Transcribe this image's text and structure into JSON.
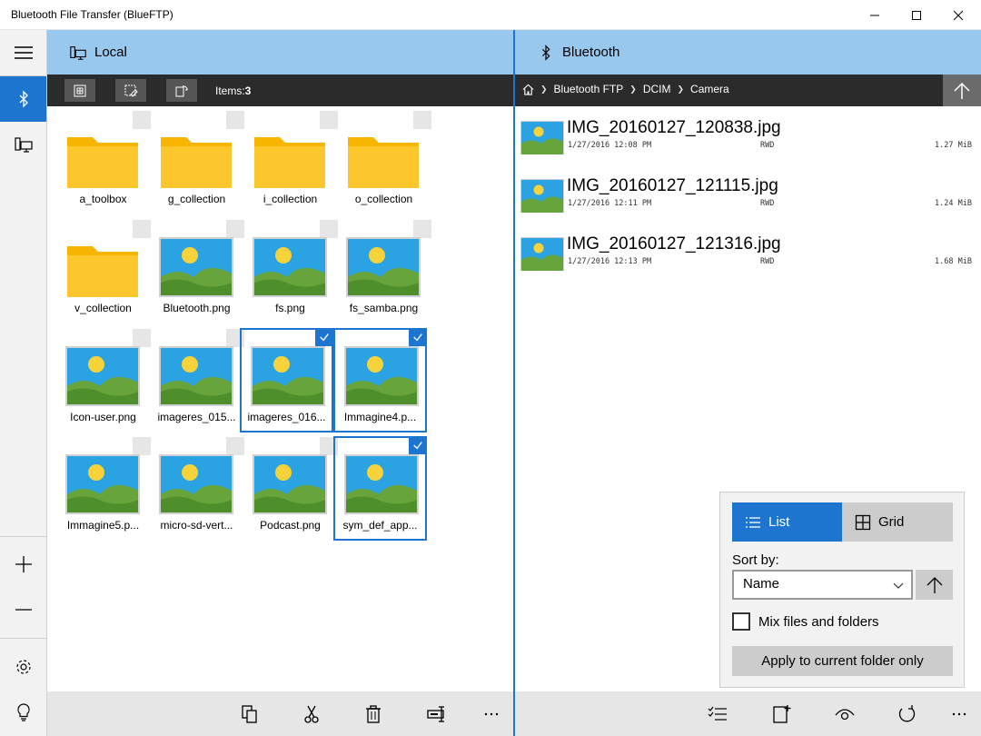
{
  "window": {
    "title": "Bluetooth File Transfer (BlueFTP)"
  },
  "left_pane": {
    "title": "Local",
    "items_label": "Items:",
    "items_count": "3",
    "tiles": [
      {
        "label": "a_toolbox",
        "kind": "folder",
        "selected": false
      },
      {
        "label": "g_collection",
        "kind": "folder",
        "selected": false
      },
      {
        "label": "i_collection",
        "kind": "folder",
        "selected": false
      },
      {
        "label": "o_collection",
        "kind": "folder",
        "selected": false
      },
      {
        "label": "v_collection",
        "kind": "folder",
        "selected": false
      },
      {
        "label": "Bluetooth.png",
        "kind": "image",
        "selected": false
      },
      {
        "label": "fs.png",
        "kind": "image",
        "selected": false
      },
      {
        "label": "fs_samba.png",
        "kind": "image",
        "selected": false
      },
      {
        "label": "Icon-user.png",
        "kind": "image",
        "selected": false
      },
      {
        "label": "imageres_015...",
        "kind": "image",
        "selected": false
      },
      {
        "label": "imageres_016...",
        "kind": "image",
        "selected": true
      },
      {
        "label": "Immagine4.p...",
        "kind": "image",
        "selected": true
      },
      {
        "label": "Immagine5.p...",
        "kind": "image",
        "selected": false
      },
      {
        "label": "micro-sd-vert...",
        "kind": "image",
        "selected": false
      },
      {
        "label": "Podcast.png",
        "kind": "image",
        "selected": false
      },
      {
        "label": "sym_def_app...",
        "kind": "image",
        "selected": true
      }
    ]
  },
  "right_pane": {
    "title": "Bluetooth",
    "breadcrumb": [
      "Bluetooth FTP",
      "DCIM",
      "Camera"
    ],
    "files": [
      {
        "name": "IMG_20160127_120838.jpg",
        "date": "1/27/2016 12:08 PM",
        "attr": "RWD",
        "size": "1.27 MiB"
      },
      {
        "name": "IMG_20160127_121115.jpg",
        "date": "1/27/2016 12:11 PM",
        "attr": "RWD",
        "size": "1.24 MiB"
      },
      {
        "name": "IMG_20160127_121316.jpg",
        "date": "1/27/2016 12:13 PM",
        "attr": "RWD",
        "size": "1.68 MiB"
      }
    ]
  },
  "view_popup": {
    "list_label": "List",
    "grid_label": "Grid",
    "sort_label": "Sort by:",
    "sort_value": "Name",
    "mix_label": "Mix files and folders",
    "apply_label": "Apply to current folder only"
  },
  "colors": {
    "accent": "#1d75d0",
    "header": "#99c8ef",
    "darkbar": "#2b2b2b",
    "folder": "#fcc62d",
    "sky": "#2ba3e3",
    "sun": "#f6d23b",
    "hill": "#67a43b"
  },
  "icons": {
    "menu": "hamburger-icon",
    "bluetooth": "bluetooth-icon",
    "computer": "computer-icon",
    "add": "plus-icon",
    "remove": "minus-icon",
    "settings": "gear-icon",
    "tips": "lightbulb-icon",
    "copy": "copy-icon",
    "cut": "scissors-icon",
    "delete": "trash-icon",
    "rename": "rename-icon",
    "more": "ellipsis-icon",
    "select": "checklist-icon",
    "new": "new-item-icon",
    "view": "eye-icon",
    "refresh": "refresh-icon",
    "home": "home-icon",
    "up": "arrow-up-icon"
  }
}
